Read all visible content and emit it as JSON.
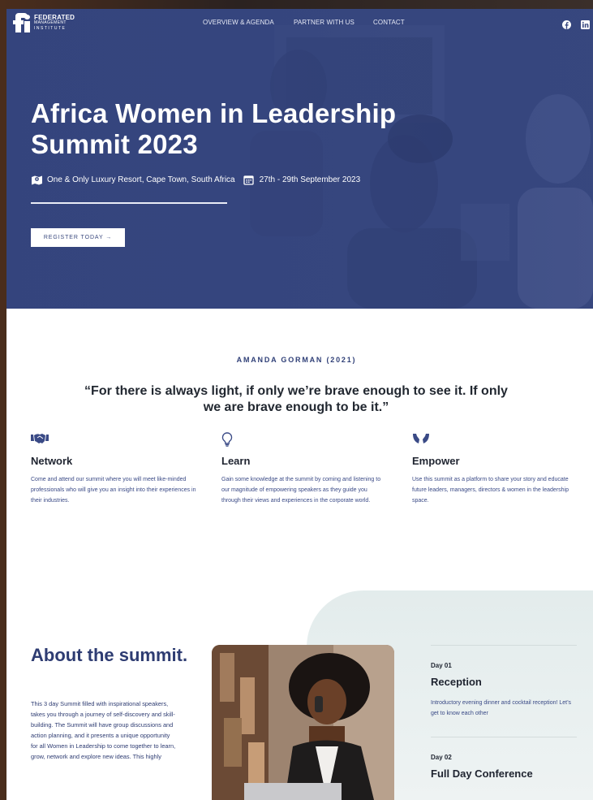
{
  "brand": {
    "name_line1": "FEDERATED",
    "name_line2": "MANAGEMENT",
    "name_line3": "INSTITUTE"
  },
  "nav": {
    "items": [
      {
        "label": "OVERVIEW & AGENDA"
      },
      {
        "label": "PARTNER WITH US"
      },
      {
        "label": "CONTACT"
      }
    ],
    "social": [
      "facebook-icon",
      "linkedin-icon"
    ]
  },
  "hero": {
    "title": "Africa Women in Leadership Summit 2023",
    "location": "One & Only Luxury Resort, Cape Town, South Africa",
    "dates": "27th - 29th September 2023",
    "cta_label": "REGISTER TODAY →",
    "overlay_color": "#34447d"
  },
  "quote": {
    "author": "AMANDA GORMAN (2021)",
    "text": "“For there is always light, if only we’re brave enough to see it. If only we are brave enough to be it.”"
  },
  "features": [
    {
      "icon": "handshake-icon",
      "title": "Network",
      "text": "Come and attend our summit where you will meet like-minded professionals who will give you an insight into their experiences in their industries."
    },
    {
      "icon": "lightbulb-icon",
      "title": "Learn",
      "text": "Gain some knowledge at the summit by coming and listening to our magnitude of empowering speakers as they guide you through their views and experiences in the corporate world."
    },
    {
      "icon": "hands-icon",
      "title": "Empower",
      "text": "Use this summit as a platform to share your story and educate future leaders, managers, directors & women in the leadership space."
    }
  ],
  "about": {
    "heading": "About the summit.",
    "text": "This 3 day Summit filled with inspirational speakers, takes you through a journey of self-discovery and skill-building. The Summit will have group discussions and action planning, and it presents a unique opportunity for all Women in Leadership to come together to learn, grow, network and explore new ideas. This highly"
  },
  "agenda": [
    {
      "label": "Day 01",
      "title": "Reception",
      "text": "Introductory evening dinner and cocktail reception! Let’s get to know each other"
    },
    {
      "label": "Day 02",
      "title": "Full Day Conference",
      "text": ""
    }
  ],
  "colors": {
    "accent": "#2e3c72",
    "text_blue": "#3a4a86",
    "tint": "#e3ecec"
  }
}
